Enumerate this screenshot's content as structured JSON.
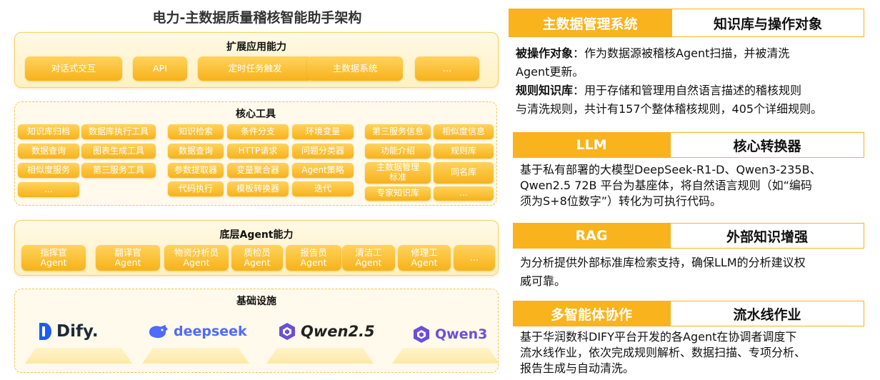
{
  "title": "电力-主数据质量稽核智能助手架构",
  "left": {
    "ext": {
      "heading": "扩展应用能力",
      "items": [
        "对话式交互",
        "API",
        "定时任务触发",
        "主数据系统",
        "..."
      ]
    },
    "core": {
      "heading": "核心工具",
      "g1": [
        "知识库归档",
        "数据库执行工具",
        "数据查询",
        "图表生成工具",
        "相似度服务",
        "第三服务工具",
        "..."
      ],
      "g2": [
        "知识检索",
        "条件分支",
        "环境变量",
        "数据查询",
        "HTTP请求",
        "问题分类器",
        "参数提取器",
        "变量聚合器",
        "Agent策略",
        "代码执行",
        "模板转换器",
        "迭代"
      ],
      "g3": [
        "第三服务信息",
        "相似度信息",
        "功能介绍",
        "规则库",
        "主数据管理",
        "标准",
        "同名库",
        "专家知识库",
        "..."
      ]
    },
    "agent": {
      "heading": "底层Agent能力",
      "items": [
        {
          "top": "指挥官",
          "bottom": "Agent"
        },
        {
          "top": "翻译官",
          "bottom": "Agent"
        },
        {
          "top": "物资分析员",
          "bottom": "Agent"
        },
        {
          "top": "质检员",
          "bottom": "Agent"
        },
        {
          "top": "报告员",
          "bottom": "Agent"
        },
        {
          "top": "清洁工",
          "bottom": "Agent"
        },
        {
          "top": "修理工",
          "bottom": "Agent"
        }
      ],
      "more": "..."
    },
    "infra": {
      "heading": "基础设施",
      "logos": [
        "Dify.",
        "deepseek",
        "Qwen2.5",
        "Qwen3"
      ]
    }
  },
  "right": [
    {
      "left": "主数据管理系统",
      "right": "知识库与操作对象",
      "lines": [
        {
          "bold": "被操作对象",
          "text": "：作为数据源被稽核Agent扫描，并被清洗"
        },
        {
          "bold": "",
          "text": "Agent更新。"
        },
        {
          "bold": "规则知识库",
          "text": "：用于存储和管理用自然语言描述的稽核规则"
        },
        {
          "bold": "",
          "text": "与清洗规则，共计有157个整体稽核规则，405个详细规则。"
        }
      ]
    },
    {
      "left": "LLM",
      "right": "核心转换器",
      "lines": [
        {
          "bold": "",
          "text": "基于私有部署的大模型DeepSeek-R1-D、Qwen3-235B、"
        },
        {
          "bold": "",
          "text": "Qwen2.5 72B 平台为基座体，将自然语言规则（如“编码"
        },
        {
          "bold": "",
          "text": "须为S+8位数字”）转化为可执行代码。"
        }
      ]
    },
    {
      "left": "RAG",
      "right": "外部知识增强",
      "lines": [
        {
          "bold": "",
          "text": "为分析提供外部标准库检索支持，确保LLM的分析建议权"
        },
        {
          "bold": "",
          "text": "威可靠。"
        }
      ]
    },
    {
      "left": "多智能体协作",
      "right": "流水线作业",
      "lines": [
        {
          "bold": "",
          "text": "基于华润数科DIFY平台开发的各Agent在协调者调度下"
        },
        {
          "bold": "",
          "text": "流水线作业，依次完成规则解析、数据扫描、专项分析、"
        },
        {
          "bold": "",
          "text": "报告生成与自动清洗。"
        }
      ]
    }
  ],
  "colors": {
    "accent": "#f9b31c",
    "panel": "#fff4d1"
  }
}
